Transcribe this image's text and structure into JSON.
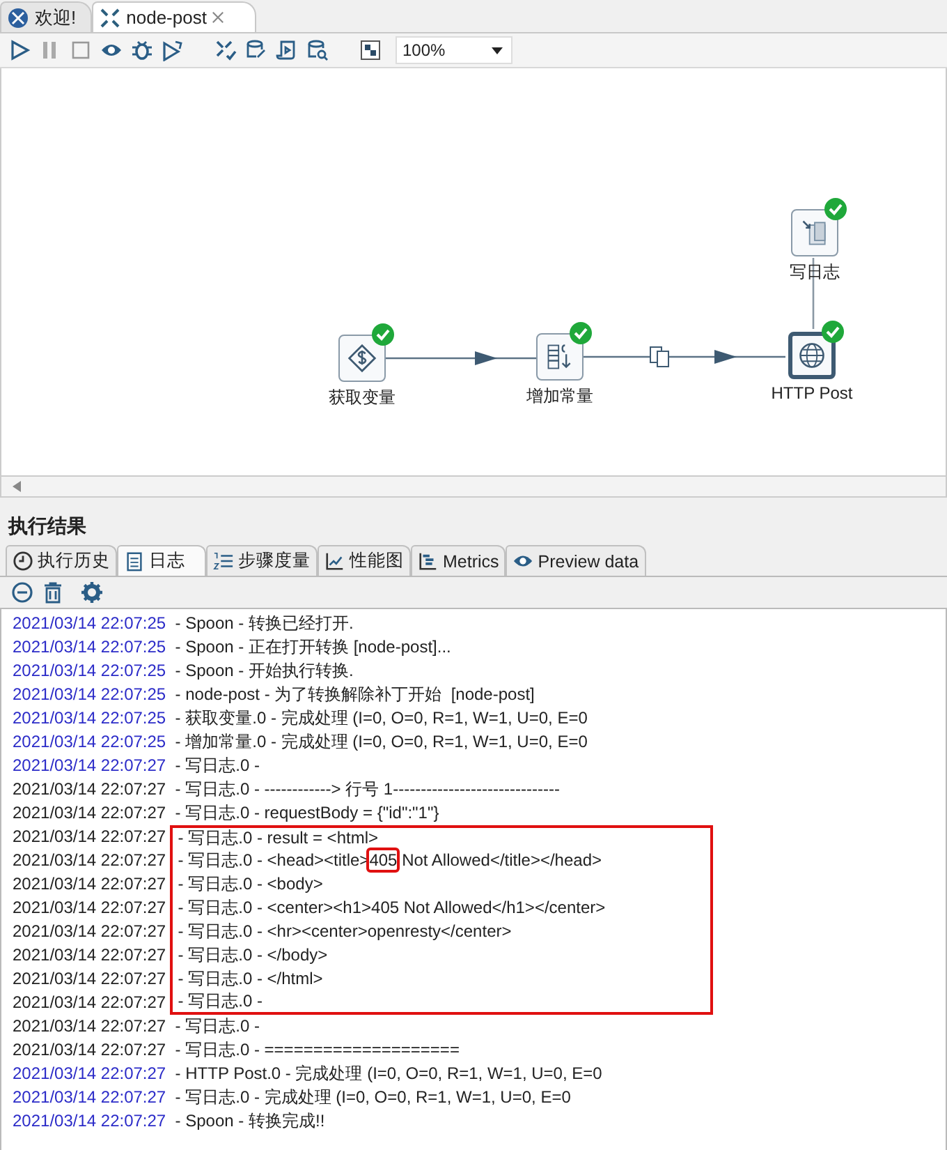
{
  "editor_tabs": [
    {
      "label": "欢迎!",
      "selected": false,
      "closable": false
    },
    {
      "label": "node-post",
      "selected": true,
      "closable": true
    }
  ],
  "toolbar": {
    "zoom": "100%"
  },
  "canvas": {
    "steps": [
      {
        "label": "写日志",
        "kind": "log",
        "succeeded": true
      },
      {
        "label": "获取变量",
        "kind": "variables",
        "succeeded": true
      },
      {
        "label": "增加常量",
        "kind": "constants",
        "succeeded": true
      },
      {
        "label": "HTTP Post",
        "kind": "http",
        "succeeded": true
      }
    ]
  },
  "results": {
    "title": "执行结果",
    "tabs": [
      {
        "label": "执行历史",
        "kind": "history",
        "selected": false
      },
      {
        "label": "日志",
        "kind": "log",
        "selected": true
      },
      {
        "label": "步骤度量",
        "kind": "steps",
        "selected": false
      },
      {
        "label": "性能图",
        "kind": "chart",
        "selected": false
      },
      {
        "label": "Metrics",
        "kind": "metrics",
        "selected": false
      },
      {
        "label": "Preview data",
        "kind": "preview",
        "selected": false
      }
    ],
    "log": [
      {
        "time": "2021/03/14 22:07:25",
        "color": "#2b2bc8",
        "message": " - Spoon - 转换已经打开.",
        "boxed": false
      },
      {
        "time": "2021/03/14 22:07:25",
        "color": "#2b2bc8",
        "message": " - Spoon - 正在打开转换 [node-post]...",
        "boxed": false
      },
      {
        "time": "2021/03/14 22:07:25",
        "color": "#2b2bc8",
        "message": " - Spoon - 开始执行转换.",
        "boxed": false
      },
      {
        "time": "2021/03/14 22:07:25",
        "color": "#2b2bc8",
        "message": " - node-post - 为了转换解除补丁开始  [node-post]",
        "boxed": false
      },
      {
        "time": "2021/03/14 22:07:25",
        "color": "#2b2bc8",
        "message": " - 获取变量.0 - 完成处理 (I=0, O=0, R=1, W=1, U=0, E=0",
        "boxed": false
      },
      {
        "time": "2021/03/14 22:07:25",
        "color": "#2b2bc8",
        "message": " - 增加常量.0 - 完成处理 (I=0, O=0, R=1, W=1, U=0, E=0",
        "boxed": false
      },
      {
        "time": "2021/03/14 22:07:27",
        "color": "#2b2bc8",
        "message": " - 写日志.0 -",
        "boxed": false
      },
      {
        "time": "2021/03/14 22:07:27",
        "color": "#222222",
        "message": " - 写日志.0 - ------------> 行号 1------------------------------",
        "boxed": false
      },
      {
        "time": "2021/03/14 22:07:27",
        "color": "#222222",
        "message": " - 写日志.0 - requestBody = {\"id\":\"1\"}",
        "boxed": false
      },
      {
        "time": "2021/03/14 22:07:27",
        "color": "#222222",
        "message": " - 写日志.0 - result = <html>",
        "boxed": true
      },
      {
        "time": "2021/03/14 22:07:27",
        "color": "#222222",
        "parts": [
          {
            "text": " - 写日志.0 - <head><title>",
            "boxed": false
          },
          {
            "text": "405",
            "boxed": true
          },
          {
            "text": " Not Allowed</title></head>",
            "boxed": false
          }
        ],
        "boxed": true
      },
      {
        "time": "2021/03/14 22:07:27",
        "color": "#222222",
        "message": " - 写日志.0 - <body>",
        "boxed": true
      },
      {
        "time": "2021/03/14 22:07:27",
        "color": "#222222",
        "message": " - 写日志.0 - <center><h1>405 Not Allowed</h1></center>",
        "boxed": true
      },
      {
        "time": "2021/03/14 22:07:27",
        "color": "#222222",
        "message": " - 写日志.0 - <hr><center>openresty</center>",
        "boxed": true
      },
      {
        "time": "2021/03/14 22:07:27",
        "color": "#222222",
        "message": " - 写日志.0 - </body>",
        "boxed": true
      },
      {
        "time": "2021/03/14 22:07:27",
        "color": "#222222",
        "message": " - 写日志.0 - </html>",
        "boxed": true
      },
      {
        "time": "2021/03/14 22:07:27",
        "color": "#222222",
        "message": " - 写日志.0 -",
        "boxed": true
      },
      {
        "time": "2021/03/14 22:07:27",
        "color": "#222222",
        "message": " - 写日志.0 -",
        "boxed": false
      },
      {
        "time": "2021/03/14 22:07:27",
        "color": "#222222",
        "message": " - 写日志.0 - ====================",
        "boxed": false
      },
      {
        "time": "2021/03/14 22:07:27",
        "color": "#2b2bc8",
        "message": " - HTTP Post.0 - 完成处理 (I=0, O=0, R=1, W=1, U=0, E=0",
        "boxed": false
      },
      {
        "time": "2021/03/14 22:07:27",
        "color": "#2b2bc8",
        "message": " - 写日志.0 - 完成处理 (I=0, O=0, R=1, W=1, U=0, E=0",
        "boxed": false
      },
      {
        "time": "2021/03/14 22:07:27",
        "color": "#2b2bc8",
        "message": " - Spoon - 转换完成!!",
        "boxed": false
      }
    ]
  }
}
